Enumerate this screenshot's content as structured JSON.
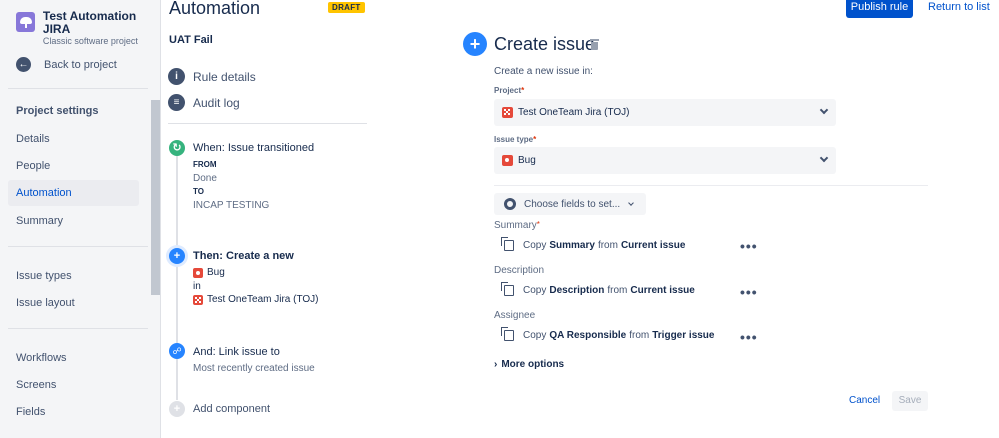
{
  "project": {
    "name": "Test Automation JIRA",
    "type": "Classic software project"
  },
  "sidebar": {
    "back_label": "Back to project",
    "section_title": "Project settings",
    "items": [
      {
        "label": "Details"
      },
      {
        "label": "People"
      },
      {
        "label": "Automation",
        "active": true
      },
      {
        "label": "Summary"
      },
      {
        "label": "Issue types"
      },
      {
        "label": "Issue layout"
      },
      {
        "label": "Workflows"
      },
      {
        "label": "Screens"
      },
      {
        "label": "Fields"
      }
    ]
  },
  "header": {
    "title": "Automation",
    "badge": "DRAFT",
    "publish_label": "Publish rule",
    "return_label": "Return to list"
  },
  "rule": {
    "name": "UAT Fail",
    "nav": [
      {
        "label": "Rule details"
      },
      {
        "label": "Audit log"
      }
    ],
    "trigger": {
      "title": "When: Issue transitioned",
      "from_label": "FROM",
      "from_value": "Done",
      "to_label": "TO",
      "to_value": "INCAP TESTING"
    },
    "action": {
      "title": "Then: Create a new",
      "issue_type": "Bug",
      "in_label": "in",
      "project": "Test OneTeam Jira (TOJ)"
    },
    "link": {
      "title": "And: Link issue to",
      "value": "Most recently created issue"
    },
    "add_component": "Add component"
  },
  "panel": {
    "title": "Create issue",
    "subtitle": "Create a new issue in:",
    "project_label": "Project",
    "project_value": "Test OneTeam Jira (TOJ)",
    "issue_type_label": "Issue type",
    "issue_type_value": "Bug",
    "choose_fields": "Choose fields to set...",
    "fields": [
      {
        "label": "Summary",
        "required": true,
        "copy": "Copy",
        "field": "Summary",
        "from": "from",
        "source": "Current issue"
      },
      {
        "label": "Description",
        "copy": "Copy",
        "field": "Description",
        "from": "from",
        "source": "Current issue"
      },
      {
        "label": "Assignee",
        "copy": "Copy",
        "field": "QA Responsible",
        "from": "from",
        "source": "Trigger issue"
      }
    ],
    "more_options": "More options",
    "cancel": "Cancel",
    "save": "Save"
  },
  "colors": {
    "primary": "#0052cc",
    "accent": "#2684ff",
    "trigger": "#36b37e",
    "draft": "#ffc400",
    "bug": "#e5493a"
  }
}
